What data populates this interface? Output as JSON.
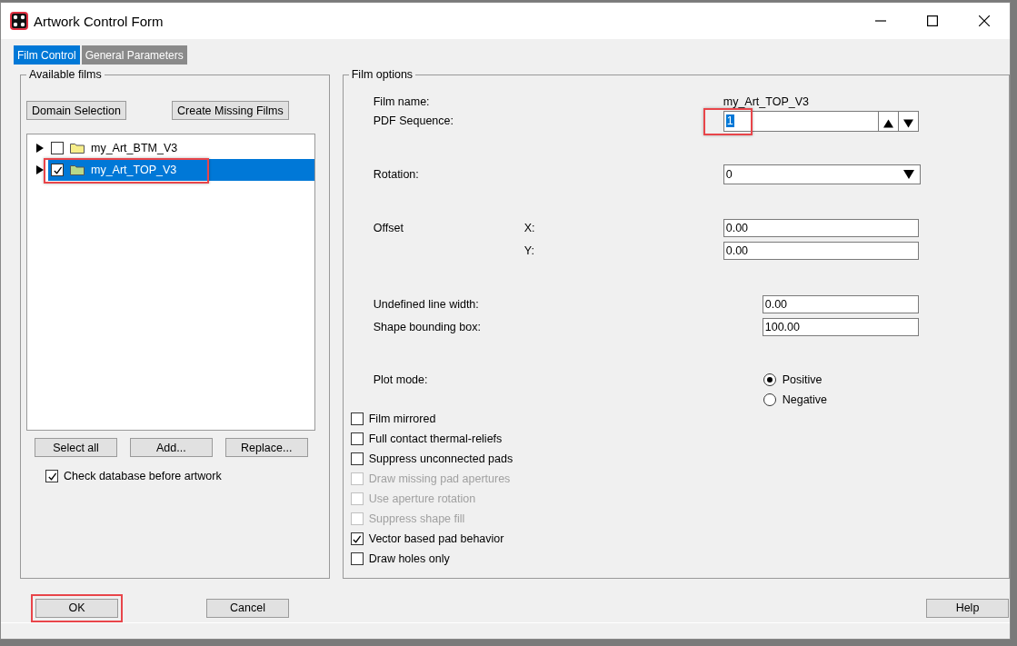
{
  "window": {
    "title": "Artwork Control Form"
  },
  "tabs": [
    {
      "label": "Film Control",
      "selected": true
    },
    {
      "label": "General Parameters",
      "selected": false
    }
  ],
  "available_films": {
    "title": "Available films",
    "top_buttons": [
      "Domain Selection",
      "Create Missing Films"
    ],
    "tree": [
      {
        "label": "my_Art_BTM_V3",
        "checked": false,
        "selected": false,
        "highlighted": false
      },
      {
        "label": "my_Art_TOP_V3",
        "checked": true,
        "selected": true,
        "highlighted": true
      }
    ],
    "buttons": [
      "Select all",
      "Add...",
      "Replace..."
    ],
    "check_database": {
      "label": "Check database before artwork",
      "checked": true
    }
  },
  "film_options": {
    "title": "Film options",
    "film_name": {
      "label": "Film name:",
      "value": "my_Art_TOP_V3"
    },
    "pdf_sequence": {
      "label": "PDF Sequence:",
      "value": "1",
      "highlighted": true
    },
    "rotation": {
      "label": "Rotation:",
      "value": "0"
    },
    "offset": {
      "label": "Offset",
      "x": {
        "label": "X:",
        "value": "0.00"
      },
      "y": {
        "label": "Y:",
        "value": "0.00"
      }
    },
    "undefined_line_width": {
      "label": "Undefined line width:",
      "value": "0.00"
    },
    "shape_bounding_box": {
      "label": "Shape bounding box:",
      "value": "100.00"
    },
    "plot_mode": {
      "label": "Plot mode:",
      "options": [
        {
          "label": "Positive",
          "selected": true
        },
        {
          "label": "Negative",
          "selected": false
        }
      ]
    },
    "checkboxes": [
      {
        "label": "Film mirrored",
        "checked": false,
        "disabled": false
      },
      {
        "label": "Full contact thermal-reliefs",
        "checked": false,
        "disabled": false
      },
      {
        "label": "Suppress unconnected pads",
        "checked": false,
        "disabled": false
      },
      {
        "label": "Draw missing pad apertures",
        "checked": false,
        "disabled": true
      },
      {
        "label": "Use aperture rotation",
        "checked": false,
        "disabled": true
      },
      {
        "label": "Suppress shape fill",
        "checked": false,
        "disabled": true
      },
      {
        "label": "Vector based pad behavior",
        "checked": true,
        "disabled": false
      },
      {
        "label": "Draw holes only",
        "checked": false,
        "disabled": false
      }
    ]
  },
  "buttons": [
    {
      "label": "OK",
      "highlighted": true
    },
    {
      "label": "Cancel",
      "highlighted": false
    },
    {
      "label": "Help",
      "highlighted": false
    }
  ]
}
